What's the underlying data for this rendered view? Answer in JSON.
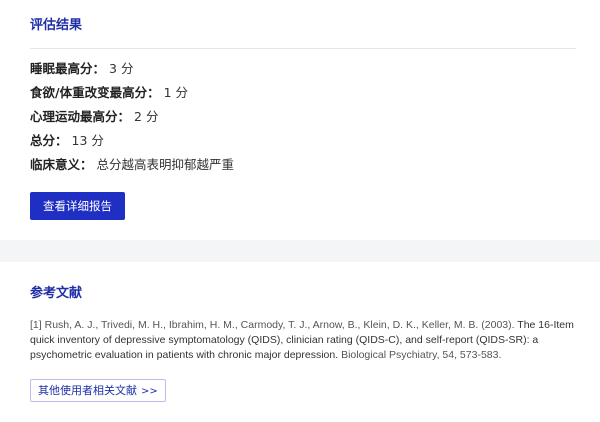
{
  "results": {
    "title": "评估结果",
    "rows": [
      {
        "key": "睡眠最高分：",
        "value": "3 分"
      },
      {
        "key": "食欲/体重改变最高分：",
        "value": "1 分"
      },
      {
        "key": "心理运动最高分：",
        "value": "2 分"
      },
      {
        "key": "总分：",
        "value": "13 分"
      },
      {
        "key": "临床意义：",
        "value": "总分越高表明抑郁越严重"
      }
    ],
    "detail_button": "查看详细报告"
  },
  "references": {
    "title": "参考文献",
    "items": [
      {
        "index": "[1]",
        "authors": "Rush, A. J., Trivedi, M. H., Ibrahim, H. M., Carmody, T. J., Arnow, B., Klein, D. K., Keller, M. B. (2003).",
        "title": "The 16-Item quick inventory of depressive symptomatology (QIDS), clinician rating (QIDS-C), and self-report (QIDS-SR): a psychometric evaluation in patients with chronic major depression.",
        "source": "Biological Psychiatry, 54, 573-583."
      }
    ],
    "more_button": "其他使用者相关文献",
    "more_chevron": ">>"
  }
}
